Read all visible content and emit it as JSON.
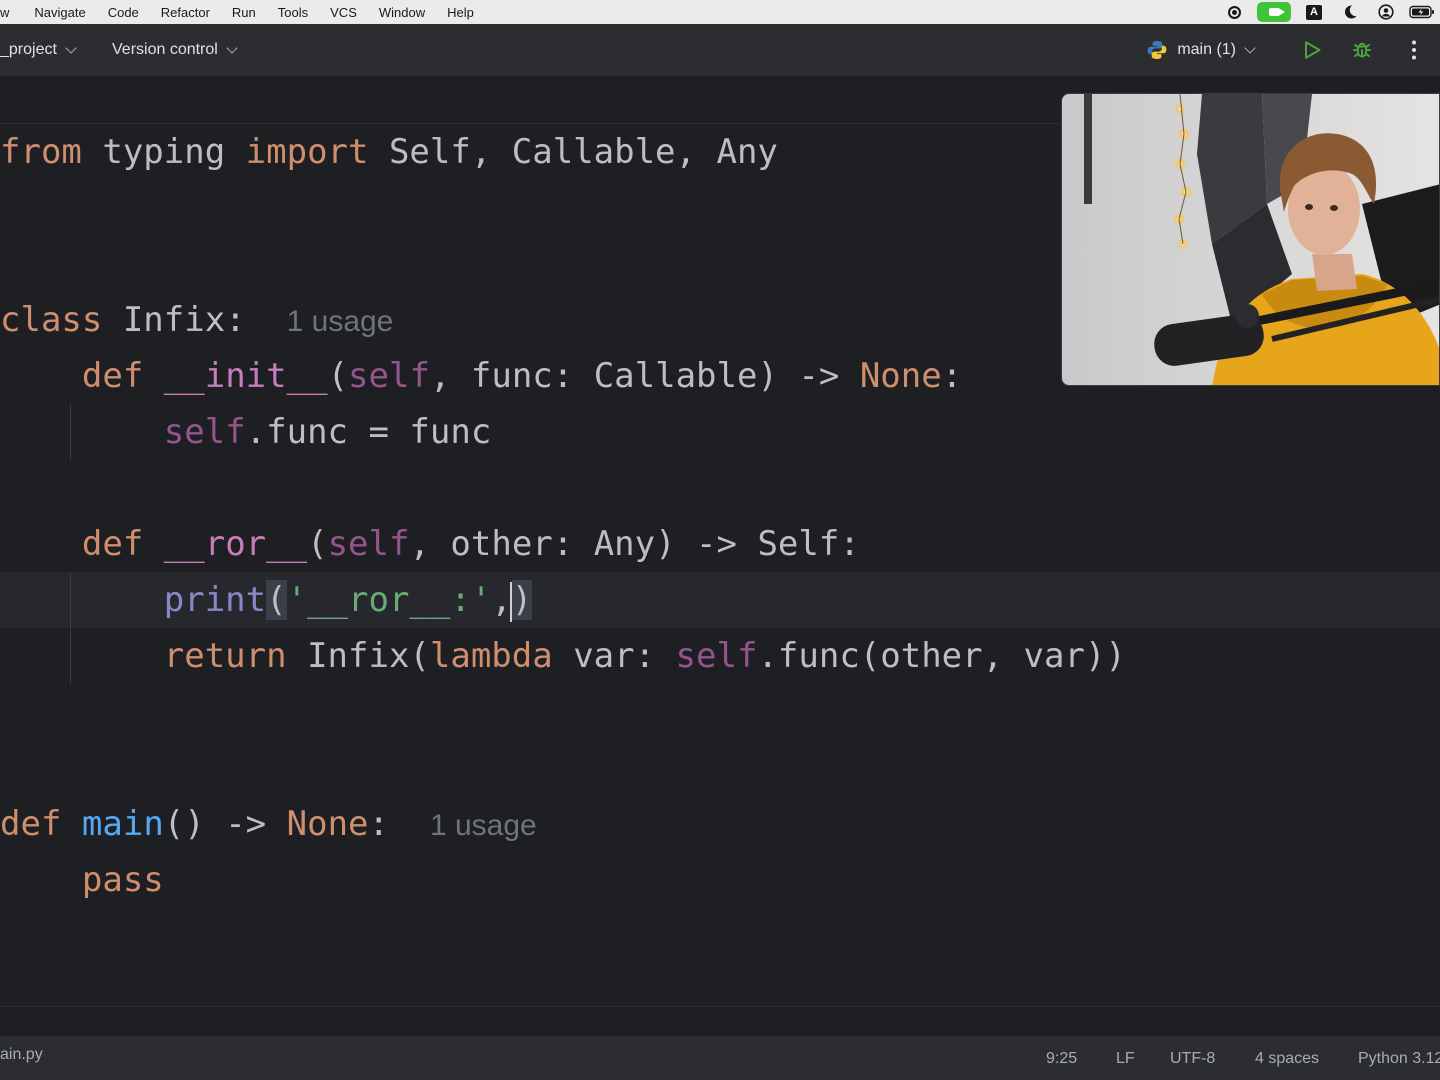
{
  "menubar": {
    "items": [
      "w",
      "Navigate",
      "Code",
      "Refactor",
      "Run",
      "Tools",
      "VCS",
      "Window",
      "Help"
    ],
    "status_icons": [
      "screen-record-icon",
      "facetime-icon",
      "input-source-icon",
      "focus-moon-icon",
      "user-icon",
      "battery-icon"
    ],
    "input_source_label": "A"
  },
  "toolbar": {
    "project": "_project",
    "version_control": "Version control",
    "run_config": "main (1)",
    "colors": {
      "run": "#4aa33a",
      "debug": "#4aa33a"
    }
  },
  "editor": {
    "lines": {
      "l1": {
        "kw_from": "from",
        "mod": " typing ",
        "kw_import": "import",
        "rest": " Self, Callable, Any"
      },
      "l4": {
        "kw": "class",
        "name": " Infix:",
        "hint": "1 usage"
      },
      "l5": {
        "indent": "    ",
        "kw": "def",
        "sp": " ",
        "name": "__init__",
        "p1": "(",
        "self": "self",
        "rest": ", func: Callable) -> ",
        "none": "None",
        "end": ":"
      },
      "l6": {
        "indent": "        ",
        "self": "self",
        "rest": ".func = func"
      },
      "l8": {
        "indent": "    ",
        "kw": "def",
        "sp": " ",
        "name": "__ror__",
        "p1": "(",
        "self": "self",
        "rest": ", other: Any) -> Self:"
      },
      "l9": {
        "indent": "        ",
        "fn": "print",
        "open": "(",
        "str": "'__ror__:'",
        "comma": ",",
        "close": ")"
      },
      "l10": {
        "indent": "        ",
        "kw": "return",
        "mid": " Infix(",
        "kw2": "lambda",
        "mid2": " var: ",
        "self": "self",
        "rest": ".func(other, var))"
      },
      "l13": {
        "kw": "def",
        "sp": " ",
        "name": "main",
        "rest": "() -> ",
        "none": "None",
        "end": ":",
        "hint": "1 usage"
      },
      "l14": {
        "indent": "    ",
        "kw": "pass"
      }
    }
  },
  "statusbar": {
    "file": "ain.py",
    "position": "9:25",
    "line_sep": "LF",
    "encoding": "UTF-8",
    "indent": "4 spaces",
    "interpreter": "Python 3.12"
  }
}
